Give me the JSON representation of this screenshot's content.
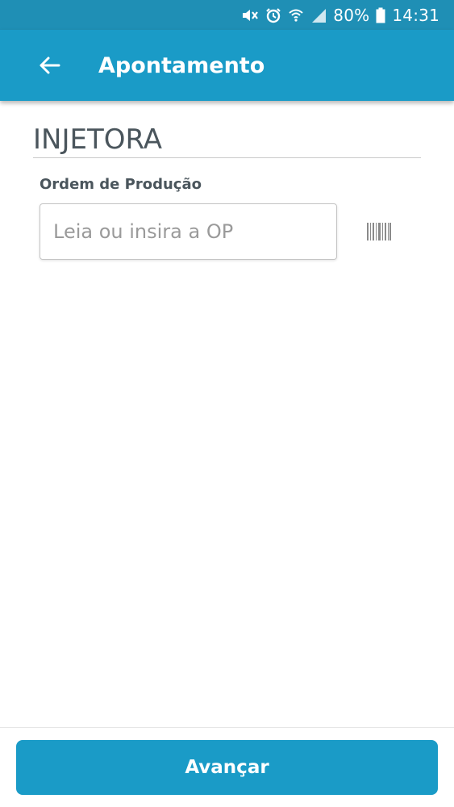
{
  "status_bar": {
    "battery": "80%",
    "time": "14:31",
    "icons": [
      "mute-vibrate-icon",
      "alarm-icon",
      "wifi-icon",
      "signal-icon",
      "battery-icon"
    ]
  },
  "app_bar": {
    "title": "Apontamento",
    "back_icon": "arrow-left-icon",
    "color": "#1a9bc7"
  },
  "content": {
    "section_title": "INJETORA",
    "field_label": "Ordem de Produção",
    "op_input": {
      "value": "",
      "placeholder": "Leia ou insira a OP"
    },
    "barcode_icon": "barcode-icon"
  },
  "footer": {
    "advance_label": "Avançar"
  },
  "colors": {
    "primary": "#1a9bc7",
    "status_bar": "#1f8fb5",
    "text_dark": "#4a555c"
  }
}
